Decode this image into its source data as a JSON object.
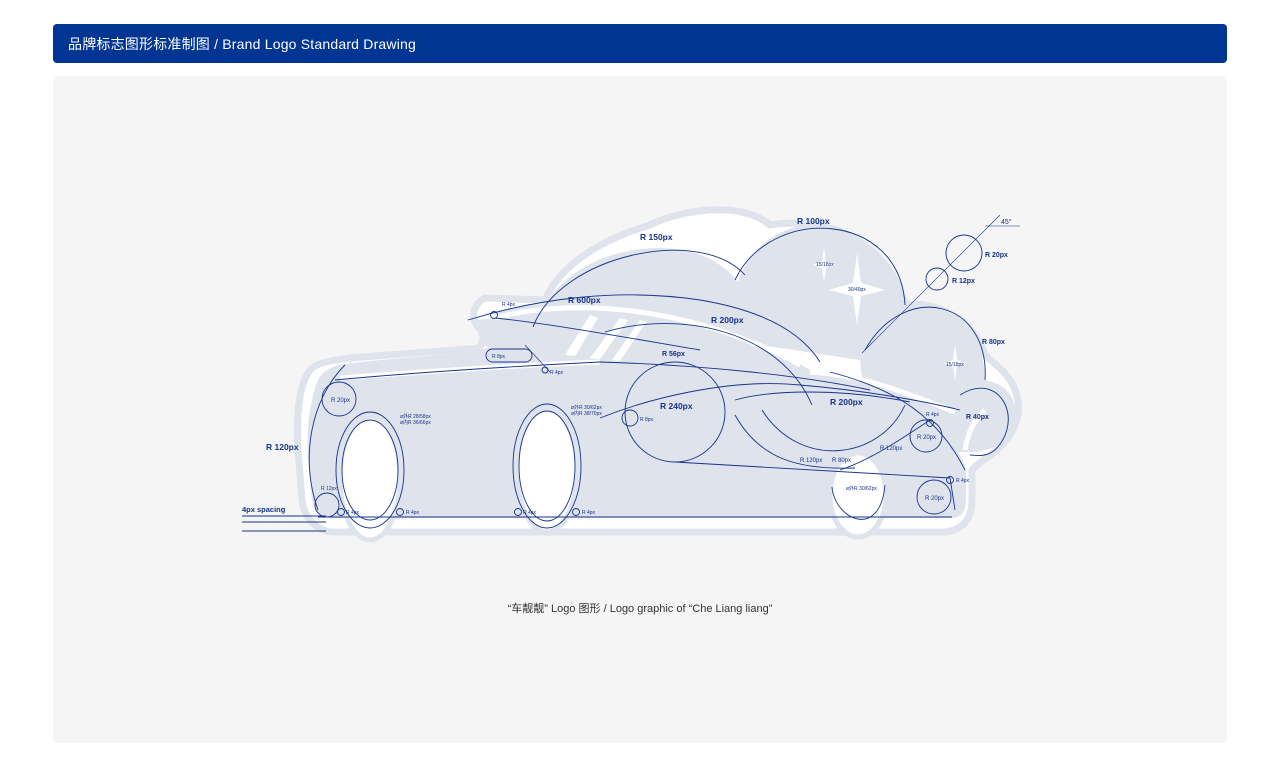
{
  "header": {
    "title": "品牌标志图形标准制图 / Brand Logo Standard Drawing"
  },
  "caption": "“车靓靓” Logo 图形 / Logo graphic of “Che Liang liang”",
  "colors": {
    "brand_blue": "#003594",
    "line_blue": "#16338c",
    "fill_light": "#dfe3ec",
    "panel_bg": "#f5f5f5"
  },
  "drawing": {
    "labels": {
      "r150": "R 150px",
      "r100": "R 100px",
      "angle45": "45°",
      "r20_top": "R 20px",
      "r12_top": "R 12px",
      "r600": "R 600px",
      "r200_upper": "R 200px",
      "r80_right": "R 80px",
      "r56": "R 56px",
      "r240": "R 240px",
      "r200_lower": "R 200px",
      "r40": "R 40px",
      "r120_left": "R 120px",
      "r20_left": "R 20px",
      "r12_left": "R 12px",
      "spacing": "4px spacing",
      "r20_mid_right": "R 20px",
      "r20_bottom_right": "R 20px",
      "r120_mid": "R 120px",
      "r80_mid": "R 80px",
      "r120_right": "R 120px",
      "r4_top": "R 4px",
      "r8_pill": "R 8px",
      "r4_pill": "R 4px",
      "r8_small": "R 8px",
      "r4_rim1": "R 4px",
      "r4_rim2": "R 4px",
      "r4_rim3": "R 4px",
      "r4_rim4": "R 4px",
      "r4_right_top": "R 4px",
      "r4_right_low": "R 4px",
      "wheel_left_1": "ø外R 28/58px",
      "wheel_left_2": "ø内R 36/66px",
      "wheel_mid_1": "ø外R 30/62px",
      "wheel_mid_2": "ø内R 38/70px",
      "wheel_right": "ø外R 30/62px",
      "star_small": "15/18px",
      "star_big": "30/40px",
      "star_right": "15/18px"
    }
  }
}
